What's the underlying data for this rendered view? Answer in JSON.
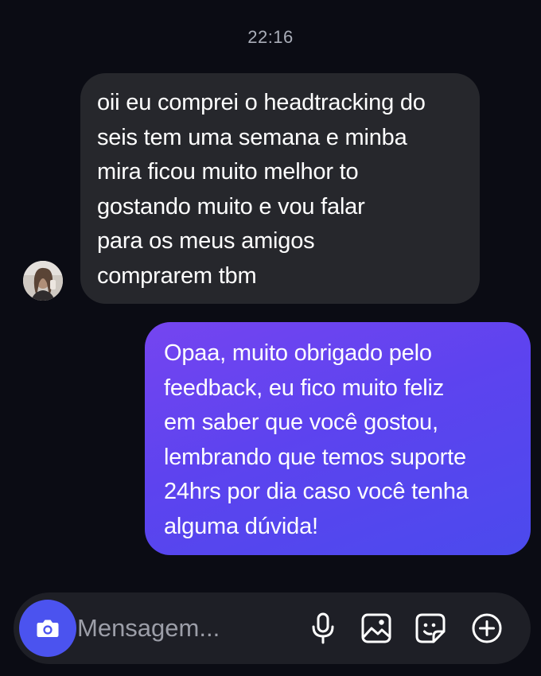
{
  "conversation": {
    "timestamp": "22:16",
    "messages": [
      {
        "sender": "other",
        "text": "oii eu comprei o headtracking do\nseis tem uma semana e minba\nmira ficou muito melhor to\ngostando muito e vou falar\npara os meus amigos\ncomprarem tbm"
      },
      {
        "sender": "me",
        "text": "Opaa, muito obrigado pelo\nfeedback, eu fico muito feliz\nem saber que você gostou,\nlembrando que temos suporte\n24hrs por dia caso você tenha\nalguma dúvida!"
      }
    ]
  },
  "composer": {
    "placeholder": "Mensagem...",
    "value": "",
    "icons": [
      "camera-icon",
      "microphone-icon",
      "gallery-icon",
      "sticker-icon",
      "plus-circle-icon"
    ]
  },
  "colors": {
    "background": "#0b0c14",
    "received_bubble": "#26272c",
    "sent_bubble_start": "#7545f0",
    "sent_bubble_end": "#4b4aed",
    "camera_button": "#4b53ef",
    "composer_bar": "#1e1f26"
  }
}
